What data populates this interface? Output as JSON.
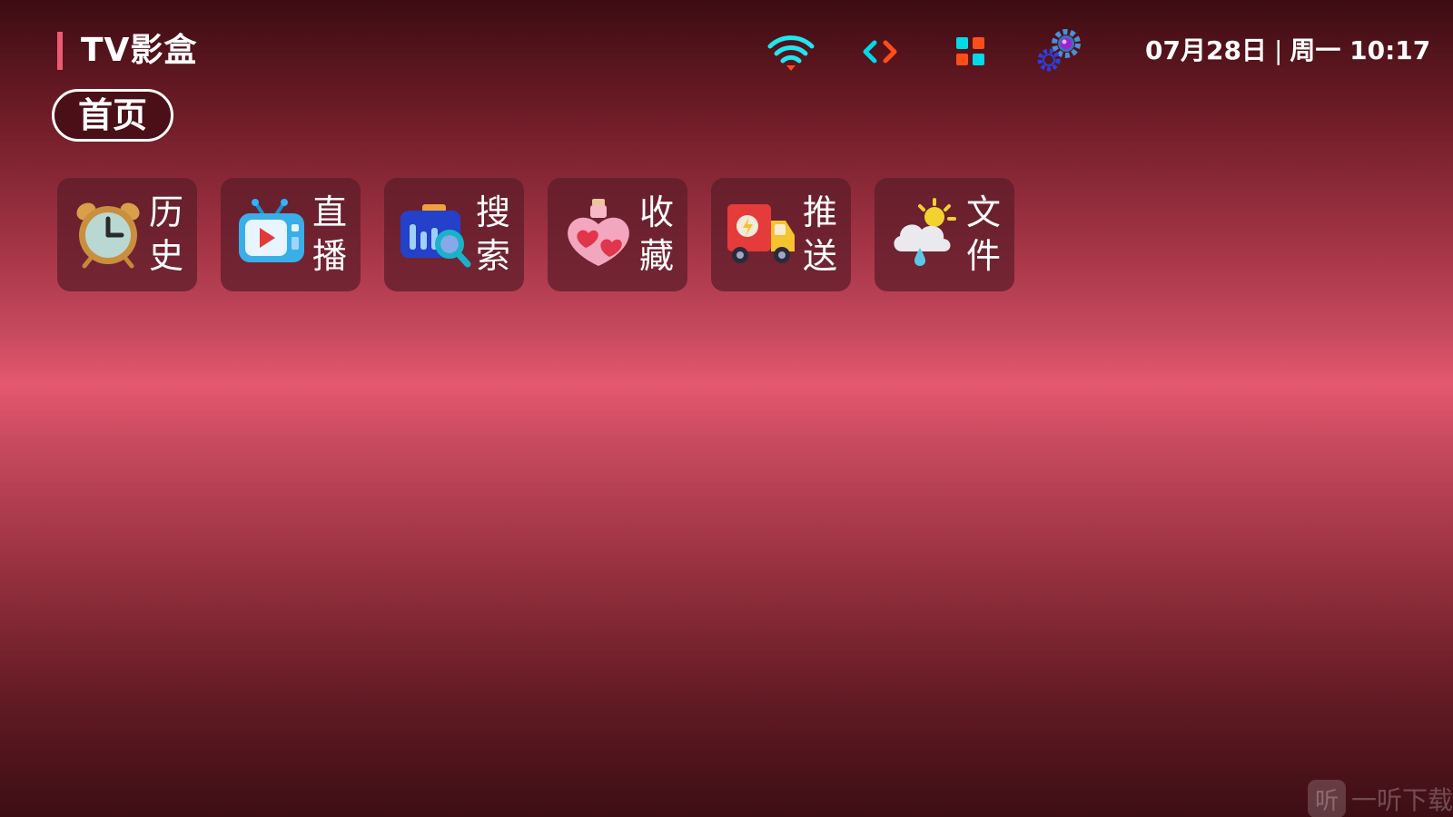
{
  "header": {
    "app_title": "TV影盒",
    "datetime": {
      "date": "07月28日",
      "separator": "|",
      "weekday": "周一",
      "time": "10:17"
    },
    "icons": [
      "wifi-icon",
      "code-icon",
      "apps-grid-icon",
      "settings-gears-icon"
    ]
  },
  "tabs": {
    "active_label": "首页"
  },
  "tiles": [
    {
      "label": "历史",
      "icon": "alarm-clock-icon"
    },
    {
      "label": "直播",
      "icon": "tv-play-icon"
    },
    {
      "label": "搜索",
      "icon": "search-chart-icon"
    },
    {
      "label": "收藏",
      "icon": "heart-bottle-icon"
    },
    {
      "label": "推送",
      "icon": "delivery-truck-icon"
    },
    {
      "label": "文件",
      "icon": "weather-cloud-icon"
    }
  ],
  "watermark": {
    "logo_text": "听",
    "text": "一听下载"
  },
  "colors": {
    "accent_bar": "#ef5a72",
    "wifi": "#22e6ee",
    "code_left": "#00d9e8",
    "code_right": "#ff4d1a",
    "tile_bg": "rgba(92,28,40,0.72)"
  }
}
